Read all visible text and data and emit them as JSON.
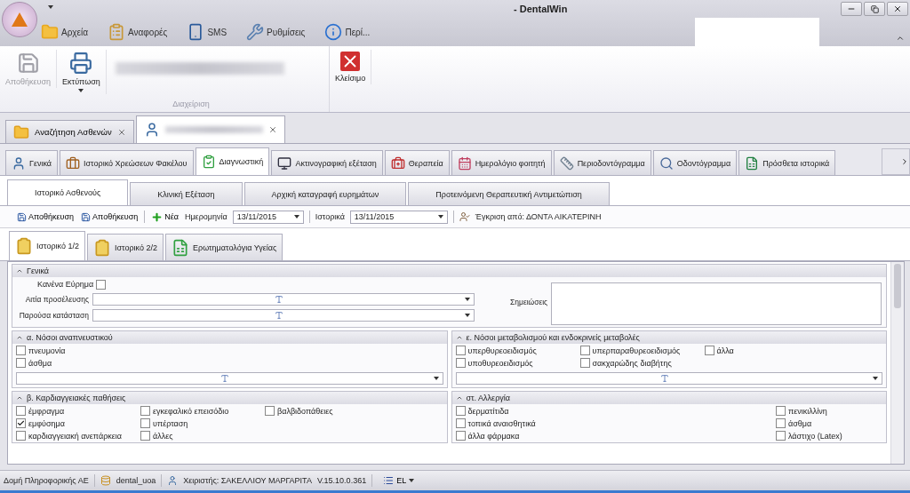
{
  "window": {
    "title": "- DentalWin"
  },
  "menu": [
    {
      "label": "Αρχεία"
    },
    {
      "label": "Αναφορές"
    },
    {
      "label": "SMS"
    },
    {
      "label": "Ρυθμίσεις"
    },
    {
      "label": "Περί..."
    }
  ],
  "ribbon": {
    "buttons": [
      {
        "label": "Αποθήκευση",
        "disabled": true
      },
      {
        "label": "Εκτύπωση",
        "disabled": false
      },
      {
        "label": "Κλείσιμο",
        "disabled": false
      }
    ],
    "group": "Διαχείριση"
  },
  "document_tabs": [
    {
      "label": "Αναζήτηση Ασθενών",
      "selected": false
    },
    {
      "selected": true
    }
  ],
  "main_tabs": [
    {
      "label": "Γενικά",
      "selected": false
    },
    {
      "label": "Ιστορικό Χρεώσεων Φακέλου",
      "selected": false
    },
    {
      "label": "Διαγνωστική",
      "selected": true
    },
    {
      "label": "Ακτινογραφική εξέταση",
      "selected": false
    },
    {
      "label": "Θεραπεία",
      "selected": false
    },
    {
      "label": "Ημερολόγιο φοιτητή",
      "selected": false
    },
    {
      "label": "Περιοδοντόγραμμα",
      "selected": false
    },
    {
      "label": "Οδοντόγραμμα",
      "selected": false
    },
    {
      "label": "Πρόσθετα ιστορικά",
      "selected": false
    }
  ],
  "sub_tabs": [
    {
      "label": "Ιστορικό Ασθενούς",
      "selected": true
    },
    {
      "label": "Κλινική Εξέταση",
      "selected": false
    },
    {
      "label": "Αρχική καταγραφή ευρημάτων",
      "selected": false
    },
    {
      "label": "Προτεινόμενη Θεραπευτική Αντιμετώπιση",
      "selected": false
    }
  ],
  "toolbar": {
    "save_buttons": [
      "Αποθήκευση",
      "Αποθήκευση"
    ],
    "new_button": "Νέα",
    "date_label": "Ημερομηνία",
    "date": "13/11/2015",
    "history_label": "Ιστορικά",
    "history_date": "13/11/2015",
    "approval": "Έγκριση από: ΔΟΝΤΑ ΑΙΚΑΤΕΡΙΝΗ"
  },
  "inner_tabs": [
    {
      "label": "Ιστορικό 1/2",
      "selected": true
    },
    {
      "label": "Ιστορικό 2/2",
      "selected": false
    },
    {
      "label": "Ερωτηματολόγια Υγείας",
      "selected": false
    }
  ],
  "general": {
    "title": "Γενικά",
    "no_finding": {
      "label": "Κανένα Εύρημα",
      "checked": false
    },
    "fields": [
      {
        "label": "Αιτία προσέλευσης"
      },
      {
        "label": "Παρούσα κατάσταση"
      }
    ],
    "notes_label": "Σημειώσεις"
  },
  "sections": [
    {
      "title": "α. Νόσοι αναπνευστικού",
      "kind": "grid",
      "has_combo": true,
      "rows": [
        [
          {
            "label": "πνευμονία",
            "checked": false
          }
        ],
        [
          {
            "label": "άσθμα",
            "checked": false
          }
        ]
      ]
    },
    {
      "title": "ε. Νόσοι μεταβολισμού και ενδοκρινείς μεταβολές",
      "kind": "grid",
      "has_combo": true,
      "rows": [
        [
          {
            "label": "υπερθυρεοειδισμός",
            "checked": false
          },
          {
            "label": "υπερπαραθυρεοειδισμός",
            "checked": false
          },
          {
            "label": "άλλα",
            "checked": false
          }
        ],
        [
          {
            "label": "υποθυρεοειδισμός",
            "checked": false
          },
          {
            "label": "σακχαρώδης διαβήτης",
            "checked": false
          }
        ]
      ]
    },
    {
      "title": "β. Καρδιαγγειακές παθήσεις",
      "kind": "grid",
      "has_combo": false,
      "rows": [
        [
          {
            "label": "έμφραγμα",
            "checked": false
          },
          {
            "label": "εγκεφαλικό επεισόδιο",
            "checked": false
          },
          {
            "label": "βαλβιδοπάθειες",
            "checked": false
          }
        ],
        [
          {
            "label": "εμφύσημα",
            "checked": true
          },
          {
            "label": "υπέρταση",
            "checked": false
          }
        ],
        [
          {
            "label": "καρδιαγγειακή ανεπάρκεια",
            "checked": false
          },
          {
            "label": "άλλες",
            "checked": false
          }
        ]
      ]
    },
    {
      "title": "στ. Αλλεργία",
      "kind": "split",
      "has_combo": false,
      "rows": [
        [
          {
            "label": "δερματίτιδα",
            "checked": false
          },
          {
            "label": "πενικιλλίνη",
            "checked": false
          }
        ],
        [
          {
            "label": "τοπικά αναισθητικά",
            "checked": false
          },
          {
            "label": "άσθμα",
            "checked": false
          }
        ],
        [
          {
            "label": "άλλα φάρμακα",
            "checked": false
          },
          {
            "label": "λάστιχο (Latex)",
            "checked": false
          }
        ]
      ]
    }
  ],
  "status_bar": {
    "company": "Δομή Πληροφορικής ΑΕ",
    "database": "dental_uoa",
    "operator": "Χειριστής: ΣΑΚΕΛΛΙΟΥ ΜΑΡΓΑΡΙΤΑ",
    "version": "V.15.10.0.361",
    "language": "EL"
  }
}
